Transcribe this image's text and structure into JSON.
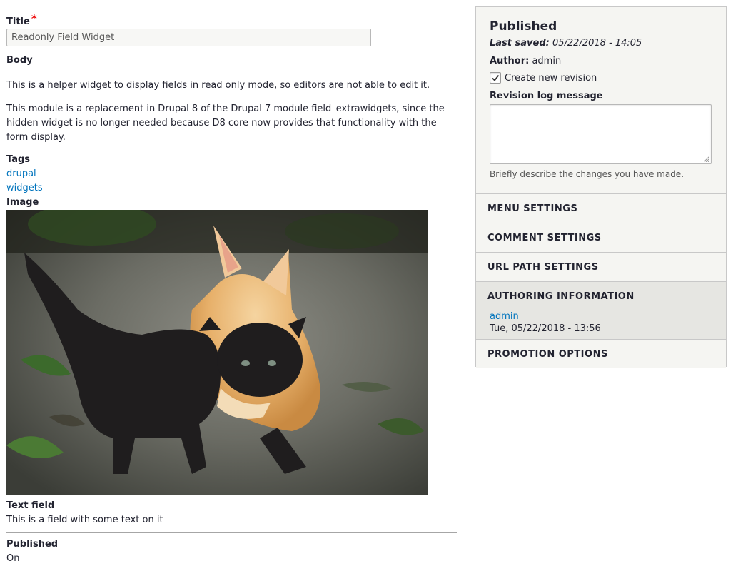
{
  "form": {
    "title_label": "Title",
    "required_mark": "*",
    "title_value": "Readonly Field Widget",
    "body_label": "Body",
    "body_paragraphs": [
      "This is a helper widget to display fields in read only mode, so editors are not able to edit it.",
      "This module is a replacement in Drupal 8 of the Drupal 7 module field_extrawidgets, since the hidden widget is no longer needed because D8 core now provides that functionality with the form display."
    ],
    "tags_label": "Tags",
    "tags": [
      "drupal",
      "widgets"
    ],
    "image_label": "Image",
    "text_field_label": "Text field",
    "text_field_value": "This is a field with some text on it",
    "published_label": "Published",
    "published_value": "On"
  },
  "sidebar": {
    "status": "Published",
    "last_saved_label": "Last saved:",
    "last_saved_value": "05/22/2018 - 14:05",
    "author_label": "Author:",
    "author_value": "admin",
    "new_revision_label": "Create new revision",
    "new_revision_checked": true,
    "revision_log_label": "Revision log message",
    "revision_log_description": "Briefly describe the changes you have made.",
    "sections": {
      "menu": "MENU SETTINGS",
      "comment": "COMMENT SETTINGS",
      "url": "URL PATH SETTINGS",
      "authoring": "AUTHORING INFORMATION",
      "promotion": "PROMOTION OPTIONS"
    },
    "authoring_user": "admin",
    "authoring_date": "Tue, 05/22/2018 - 13:56"
  },
  "colors": {
    "link": "#0074bd",
    "required": "#ee0000",
    "sidebar_bg": "#f5f5f2"
  },
  "icons": {
    "checkbox": "checkmark-icon",
    "textarea_resize": "resize-handle-icon"
  }
}
